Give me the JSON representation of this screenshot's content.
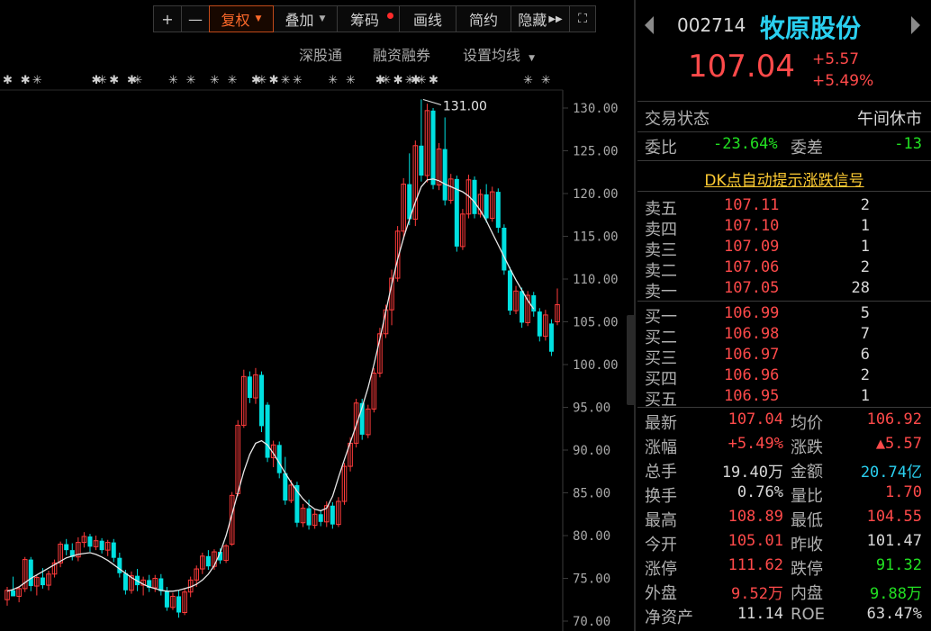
{
  "toolbar": {
    "plus": "+",
    "minus": "—",
    "fuquan": "复权",
    "overlay": "叠加",
    "chips": "筹码",
    "draw": "画线",
    "simple": "简约",
    "hide": "隐藏"
  },
  "subbar": {
    "shenguton": "深股通",
    "margin": "融资融券",
    "ma_settings": "设置均线"
  },
  "chart": {
    "peak_label": "131.00",
    "colors": {
      "up": "#ff3b3b",
      "down": "#00e0e0",
      "ma": "#e8e8e8",
      "axis": "#a8a8a8"
    }
  },
  "chart_data": {
    "type": "candlestick",
    "ylim": [
      70,
      131
    ],
    "yticks": [
      "130.00",
      "125.00",
      "120.00",
      "115.00",
      "110.00",
      "105.00",
      "100.00",
      "95.00",
      "90.00",
      "85.00",
      "80.00",
      "75.00",
      "70.00"
    ],
    "peak": 131.0,
    "candles": [
      {
        "o": 72.5,
        "h": 74.0,
        "l": 71.8,
        "c": 73.6
      },
      {
        "o": 73.6,
        "h": 75.2,
        "l": 72.9,
        "c": 72.9
      },
      {
        "o": 72.9,
        "h": 74.0,
        "l": 72.2,
        "c": 73.8
      },
      {
        "o": 73.8,
        "h": 77.5,
        "l": 73.4,
        "c": 77.2
      },
      {
        "o": 77.2,
        "h": 77.5,
        "l": 73.5,
        "c": 74.1
      },
      {
        "o": 74.1,
        "h": 75.4,
        "l": 73.0,
        "c": 75.1
      },
      {
        "o": 75.1,
        "h": 76.2,
        "l": 73.8,
        "c": 74.2
      },
      {
        "o": 74.2,
        "h": 75.9,
        "l": 73.6,
        "c": 75.5
      },
      {
        "o": 75.5,
        "h": 77.2,
        "l": 75.1,
        "c": 76.8
      },
      {
        "o": 76.8,
        "h": 79.3,
        "l": 76.3,
        "c": 79.0
      },
      {
        "o": 79.0,
        "h": 79.6,
        "l": 77.7,
        "c": 78.3
      },
      {
        "o": 78.3,
        "h": 79.1,
        "l": 77.1,
        "c": 77.5
      },
      {
        "o": 77.5,
        "h": 79.8,
        "l": 77.0,
        "c": 79.2
      },
      {
        "o": 79.2,
        "h": 80.4,
        "l": 78.6,
        "c": 79.9
      },
      {
        "o": 79.9,
        "h": 80.2,
        "l": 78.1,
        "c": 78.7
      },
      {
        "o": 78.7,
        "h": 80.0,
        "l": 78.3,
        "c": 79.4
      },
      {
        "o": 79.4,
        "h": 79.7,
        "l": 77.9,
        "c": 78.3
      },
      {
        "o": 78.3,
        "h": 79.5,
        "l": 77.6,
        "c": 79.2
      },
      {
        "o": 79.2,
        "h": 79.6,
        "l": 76.9,
        "c": 77.4
      },
      {
        "o": 77.4,
        "h": 78.0,
        "l": 75.1,
        "c": 75.6
      },
      {
        "o": 75.6,
        "h": 76.0,
        "l": 73.1,
        "c": 73.6
      },
      {
        "o": 73.6,
        "h": 75.8,
        "l": 73.2,
        "c": 75.3
      },
      {
        "o": 75.3,
        "h": 76.1,
        "l": 73.5,
        "c": 74.2
      },
      {
        "o": 74.2,
        "h": 75.2,
        "l": 73.0,
        "c": 74.8
      },
      {
        "o": 74.8,
        "h": 75.4,
        "l": 73.4,
        "c": 73.9
      },
      {
        "o": 73.9,
        "h": 75.4,
        "l": 73.4,
        "c": 75.0
      },
      {
        "o": 75.0,
        "h": 75.5,
        "l": 73.0,
        "c": 73.5
      },
      {
        "o": 73.5,
        "h": 74.0,
        "l": 71.2,
        "c": 71.6
      },
      {
        "o": 71.6,
        "h": 73.3,
        "l": 71.3,
        "c": 72.9
      },
      {
        "o": 72.9,
        "h": 73.6,
        "l": 70.4,
        "c": 71.0
      },
      {
        "o": 71.0,
        "h": 73.8,
        "l": 70.7,
        "c": 73.4
      },
      {
        "o": 73.4,
        "h": 75.2,
        "l": 72.8,
        "c": 74.8
      },
      {
        "o": 74.8,
        "h": 76.5,
        "l": 74.0,
        "c": 76.1
      },
      {
        "o": 76.1,
        "h": 78.0,
        "l": 75.5,
        "c": 77.6
      },
      {
        "o": 77.6,
        "h": 78.3,
        "l": 76.0,
        "c": 76.4
      },
      {
        "o": 76.4,
        "h": 78.4,
        "l": 76.0,
        "c": 78.1
      },
      {
        "o": 78.1,
        "h": 78.5,
        "l": 76.7,
        "c": 77.1
      },
      {
        "o": 77.1,
        "h": 79.0,
        "l": 76.8,
        "c": 78.8
      },
      {
        "o": 79.0,
        "h": 85.1,
        "l": 78.8,
        "c": 84.7
      },
      {
        "o": 84.9,
        "h": 93.5,
        "l": 84.6,
        "c": 92.9
      },
      {
        "o": 92.9,
        "h": 99.4,
        "l": 92.6,
        "c": 98.6
      },
      {
        "o": 98.6,
        "h": 99.2,
        "l": 95.5,
        "c": 96.1
      },
      {
        "o": 96.1,
        "h": 99.6,
        "l": 95.4,
        "c": 98.8
      },
      {
        "o": 98.8,
        "h": 99.2,
        "l": 92.1,
        "c": 92.8
      },
      {
        "o": 95.3,
        "h": 95.6,
        "l": 88.6,
        "c": 89.1
      },
      {
        "o": 89.1,
        "h": 91.1,
        "l": 88.0,
        "c": 90.6
      },
      {
        "o": 90.6,
        "h": 91.0,
        "l": 86.7,
        "c": 87.3
      },
      {
        "o": 87.3,
        "h": 89.2,
        "l": 83.6,
        "c": 84.1
      },
      {
        "o": 84.1,
        "h": 86.5,
        "l": 83.8,
        "c": 85.9
      },
      {
        "o": 85.9,
        "h": 86.3,
        "l": 81.0,
        "c": 81.5
      },
      {
        "o": 81.5,
        "h": 83.7,
        "l": 81.0,
        "c": 83.2
      },
      {
        "o": 83.2,
        "h": 84.2,
        "l": 80.7,
        "c": 81.2
      },
      {
        "o": 81.2,
        "h": 83.1,
        "l": 80.8,
        "c": 82.5
      },
      {
        "o": 82.5,
        "h": 83.0,
        "l": 81.1,
        "c": 81.6
      },
      {
        "o": 81.6,
        "h": 84.0,
        "l": 81.0,
        "c": 83.5
      },
      {
        "o": 83.5,
        "h": 83.9,
        "l": 80.8,
        "c": 81.3
      },
      {
        "o": 81.3,
        "h": 84.5,
        "l": 81.0,
        "c": 84.0
      },
      {
        "o": 84.0,
        "h": 88.5,
        "l": 83.6,
        "c": 88.1
      },
      {
        "o": 88.1,
        "h": 91.5,
        "l": 87.5,
        "c": 90.8
      },
      {
        "o": 90.8,
        "h": 96.0,
        "l": 90.3,
        "c": 95.5
      },
      {
        "o": 95.5,
        "h": 96.0,
        "l": 91.2,
        "c": 91.8
      },
      {
        "o": 91.8,
        "h": 95.3,
        "l": 91.4,
        "c": 94.8
      },
      {
        "o": 94.8,
        "h": 99.6,
        "l": 94.4,
        "c": 99.0
      },
      {
        "o": 99.0,
        "h": 104.3,
        "l": 98.5,
        "c": 103.6
      },
      {
        "o": 103.6,
        "h": 107.0,
        "l": 103.1,
        "c": 106.4
      },
      {
        "o": 106.4,
        "h": 111.1,
        "l": 104.6,
        "c": 110.1
      },
      {
        "o": 110.1,
        "h": 116.2,
        "l": 109.7,
        "c": 115.6
      },
      {
        "o": 115.6,
        "h": 121.8,
        "l": 114.6,
        "c": 121.1
      },
      {
        "o": 121.1,
        "h": 124.7,
        "l": 116.3,
        "c": 117.0
      },
      {
        "o": 117.0,
        "h": 126.2,
        "l": 116.2,
        "c": 125.6
      },
      {
        "o": 125.6,
        "h": 131.0,
        "l": 121.4,
        "c": 122.1
      },
      {
        "o": 122.1,
        "h": 130.5,
        "l": 121.3,
        "c": 129.7
      },
      {
        "o": 129.7,
        "h": 130.0,
        "l": 120.5,
        "c": 121.0
      },
      {
        "o": 121.0,
        "h": 125.9,
        "l": 120.4,
        "c": 125.2
      },
      {
        "o": 125.2,
        "h": 128.9,
        "l": 118.6,
        "c": 119.2
      },
      {
        "o": 119.2,
        "h": 122.3,
        "l": 118.8,
        "c": 121.7
      },
      {
        "o": 121.7,
        "h": 122.1,
        "l": 113.2,
        "c": 113.8
      },
      {
        "o": 113.8,
        "h": 118.2,
        "l": 113.4,
        "c": 117.6
      },
      {
        "o": 117.6,
        "h": 122.2,
        "l": 117.1,
        "c": 121.6
      },
      {
        "o": 121.6,
        "h": 122.0,
        "l": 117.1,
        "c": 117.6
      },
      {
        "o": 117.6,
        "h": 120.5,
        "l": 117.2,
        "c": 119.9
      },
      {
        "o": 119.9,
        "h": 121.1,
        "l": 116.6,
        "c": 117.1
      },
      {
        "o": 117.1,
        "h": 120.8,
        "l": 116.7,
        "c": 120.2
      },
      {
        "o": 120.2,
        "h": 120.6,
        "l": 115.4,
        "c": 116.0
      },
      {
        "o": 116.0,
        "h": 116.4,
        "l": 110.5,
        "c": 111.0
      },
      {
        "o": 111.0,
        "h": 111.4,
        "l": 105.8,
        "c": 106.3
      },
      {
        "o": 106.3,
        "h": 109.2,
        "l": 105.9,
        "c": 108.6
      },
      {
        "o": 108.6,
        "h": 109.0,
        "l": 104.3,
        "c": 104.9
      },
      {
        "o": 104.9,
        "h": 108.6,
        "l": 104.5,
        "c": 108.1
      },
      {
        "o": 108.1,
        "h": 108.5,
        "l": 105.6,
        "c": 106.2
      },
      {
        "o": 106.2,
        "h": 106.6,
        "l": 102.7,
        "c": 103.3
      },
      {
        "o": 103.3,
        "h": 106.4,
        "l": 102.8,
        "c": 105.8
      },
      {
        "o": 104.8,
        "h": 105.3,
        "l": 101.0,
        "c": 101.5
      },
      {
        "o": 105.0,
        "h": 108.9,
        "l": 104.6,
        "c": 107.0
      }
    ],
    "ma": [
      73.5,
      73.7,
      74.0,
      74.5,
      75.0,
      75.4,
      75.8,
      76.2,
      76.6,
      77.0,
      77.4,
      77.6,
      77.8,
      77.9,
      78.0,
      77.8,
      77.5,
      77.1,
      76.6,
      76.1,
      75.6,
      75.1,
      74.7,
      74.3,
      74.0,
      73.8,
      73.6,
      73.5,
      73.5,
      73.6,
      73.8,
      74.0,
      74.3,
      74.8,
      75.5,
      76.5,
      78.0,
      80.0,
      82.5,
      85.0,
      87.5,
      89.5,
      90.8,
      91.1,
      90.6,
      89.6,
      88.5,
      87.3,
      86.2,
      85.2,
      84.3,
      83.6,
      83.1,
      82.9,
      83.2,
      84.6,
      86.8,
      88.9,
      90.9,
      92.9,
      95.0,
      97.3,
      100.0,
      103.0,
      106.2,
      109.4,
      112.3,
      114.8,
      117.0,
      119.0,
      120.8,
      121.6,
      121.7,
      121.5,
      121.1,
      120.8,
      120.5,
      120.2,
      119.7,
      119.0,
      118.0,
      116.8,
      115.4,
      114.0,
      112.6,
      111.2,
      109.9,
      108.7,
      107.5,
      106.5
    ]
  },
  "quote": {
    "code": "002714",
    "name": "牧原股份",
    "price": "107.04",
    "change": "+5.57",
    "change_pct": "+5.49%"
  },
  "status": {
    "label": "交易状态",
    "value": "午间休市",
    "weibi_label": "委比",
    "weibi_value": "-23.64%",
    "weicha_label": "委差",
    "weicha_value": "-13"
  },
  "dk_link": "DK点自动提示涨跌信号",
  "orderbook": {
    "asks": [
      {
        "label": "卖五",
        "price": "107.11",
        "vol": "2"
      },
      {
        "label": "卖四",
        "price": "107.10",
        "vol": "1"
      },
      {
        "label": "卖三",
        "price": "107.09",
        "vol": "1"
      },
      {
        "label": "卖二",
        "price": "107.06",
        "vol": "2"
      },
      {
        "label": "卖一",
        "price": "107.05",
        "vol": "28"
      }
    ],
    "bids": [
      {
        "label": "买一",
        "price": "106.99",
        "vol": "5"
      },
      {
        "label": "买二",
        "price": "106.98",
        "vol": "7"
      },
      {
        "label": "买三",
        "price": "106.97",
        "vol": "6"
      },
      {
        "label": "买四",
        "price": "106.96",
        "vol": "2"
      },
      {
        "label": "买五",
        "price": "106.95",
        "vol": "1"
      }
    ]
  },
  "stats": [
    {
      "l1": "最新",
      "v1": "107.04",
      "c1": "red",
      "l2": "均价",
      "v2": "106.92",
      "c2": "red"
    },
    {
      "l1": "涨幅",
      "v1": "+5.49%",
      "c1": "red",
      "l2": "涨跌",
      "v2": "▲5.57",
      "c2": "red"
    },
    {
      "l1": "总手",
      "v1": "19.40万",
      "c1": "white",
      "l2": "金额",
      "v2": "20.74亿",
      "c2": "cyan"
    },
    {
      "l1": "换手",
      "v1": "0.76%",
      "c1": "white",
      "l2": "量比",
      "v2": "1.70",
      "c2": "red"
    },
    {
      "l1": "最高",
      "v1": "108.89",
      "c1": "red",
      "l2": "最低",
      "v2": "104.55",
      "c2": "red"
    },
    {
      "l1": "今开",
      "v1": "105.01",
      "c1": "red",
      "l2": "昨收",
      "v2": "101.47",
      "c2": "white"
    },
    {
      "l1": "涨停",
      "v1": "111.62",
      "c1": "red",
      "l2": "跌停",
      "v2": "91.32",
      "c2": "green"
    },
    {
      "l1": "外盘",
      "v1": "9.52万",
      "c1": "red",
      "l2": "内盘",
      "v2": "9.88万",
      "c2": "green"
    },
    {
      "l1": "净资产",
      "v1": "11.14",
      "c1": "white",
      "l2": "ROE",
      "v2": "63.47%",
      "c2": "white"
    }
  ]
}
